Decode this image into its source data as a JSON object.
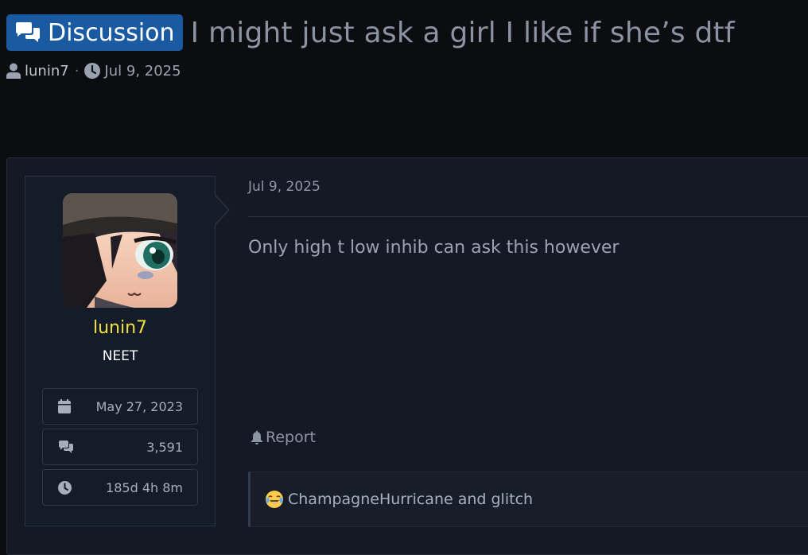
{
  "thread": {
    "prefix": "Discussion",
    "title": "I might just ask a girl I like if she’s dtf",
    "author": "lunin7",
    "separator": "·",
    "date": "Jul 9, 2025"
  },
  "post": {
    "date": "Jul 9, 2025",
    "message": "Only high t low inhib can ask this however",
    "report_label": "Report",
    "reactions": {
      "emoji": "crying-laughing-emoji",
      "users_text": "ChampagneHurricane and glitch"
    }
  },
  "user": {
    "name": "lunin7",
    "title": "NEET",
    "stats": {
      "joined": "May 27, 2023",
      "messages": "3,591",
      "online_time": "185d 4h 8m"
    }
  },
  "colors": {
    "badge": "#1a5aa1",
    "username": "#f1e13e",
    "background": "#0c0d11",
    "panel": "#151925"
  }
}
